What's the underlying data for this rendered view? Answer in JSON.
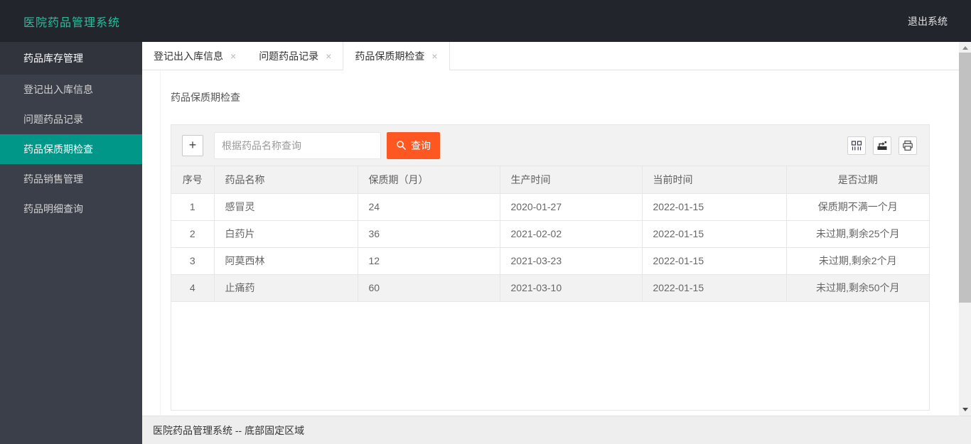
{
  "colors": {
    "header_bg": "#22252C",
    "sidebar_bg": "#3b3f4a",
    "title_teal": "#2BBE9E",
    "active_menu_teal": "#009688",
    "search_button_orange": "#FF5722",
    "status_blue": "#1414f0",
    "status_green": "#008000",
    "toolbar_gray": "#f2f2f2",
    "border_gray": "#e6e6e6"
  },
  "header": {
    "title": "医院药品管理系统",
    "logout_label": "退出系统"
  },
  "sidebar": {
    "group_title": "药品库存管理",
    "items": [
      {
        "label": "登记出入库信息"
      },
      {
        "label": "问题药品记录"
      },
      {
        "label": "药品保质期检查",
        "active": true
      },
      {
        "label": "药品销售管理"
      },
      {
        "label": "药品明细查询"
      }
    ]
  },
  "tabs": [
    {
      "label": "登记出入库信息"
    },
    {
      "label": "问题药品记录"
    },
    {
      "label": "药品保质期检查",
      "active": true
    }
  ],
  "page": {
    "breadcrumb": "药品保质期检查"
  },
  "toolbar": {
    "add_label": "+",
    "search_placeholder": "根据药品名称查询",
    "search_value": "",
    "search_button_label": "查询",
    "right_icons": [
      "columns-icon",
      "export-icon",
      "print-icon"
    ]
  },
  "table": {
    "columns": [
      "序号",
      "药品名称",
      "保质期（月）",
      "生产时间",
      "当前时间",
      "是否过期"
    ],
    "rows": [
      {
        "seq": "1",
        "name": "感冒灵",
        "shelf_months": "24",
        "production_date": "2020-01-27",
        "current_date": "2022-01-15",
        "status": "保质期不满一个月",
        "status_color": "blue"
      },
      {
        "seq": "2",
        "name": "白药片",
        "shelf_months": "36",
        "production_date": "2021-02-02",
        "current_date": "2022-01-15",
        "status": "未过期,剩余25个月",
        "status_color": "green"
      },
      {
        "seq": "3",
        "name": "阿莫西林",
        "shelf_months": "12",
        "production_date": "2021-03-23",
        "current_date": "2022-01-15",
        "status": "未过期,剩余2个月",
        "status_color": "green"
      },
      {
        "seq": "4",
        "name": "止痛药",
        "shelf_months": "60",
        "production_date": "2021-03-10",
        "current_date": "2022-01-15",
        "status": "未过期,剩余50个月",
        "status_color": "green"
      }
    ]
  },
  "footer": {
    "text": "医院药品管理系统 -- 底部固定区域"
  }
}
